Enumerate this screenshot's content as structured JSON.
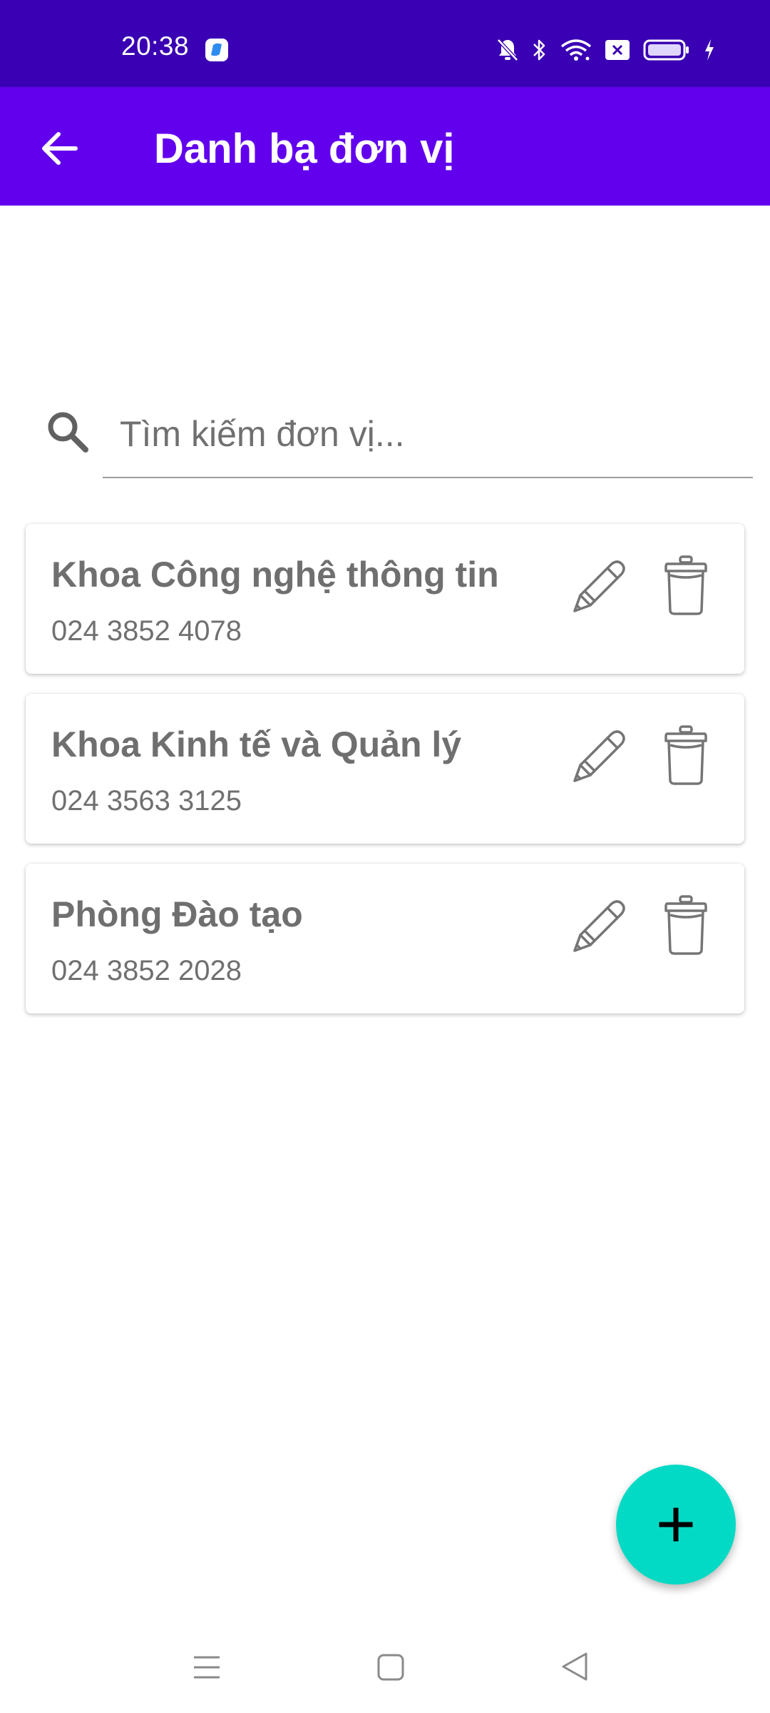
{
  "status_bar": {
    "time": "20:38",
    "icons": [
      "app-notification-icon",
      "bell-off-icon",
      "bluetooth-icon",
      "wifi-icon",
      "sim-off-icon",
      "battery-icon",
      "charging-icon"
    ]
  },
  "app_bar": {
    "back_icon": "arrow-back-icon",
    "title": "Danh bạ đơn vị"
  },
  "search": {
    "icon": "search-icon",
    "placeholder": "Tìm kiếm đơn vị...",
    "value": ""
  },
  "units": [
    {
      "name": "Khoa Công nghệ thông tin",
      "phone": "024 3852 4078"
    },
    {
      "name": "Khoa Kinh tế và Quản lý",
      "phone": "024 3563 3125"
    },
    {
      "name": "Phòng Đào tạo",
      "phone": "024 3852 2028"
    }
  ],
  "actions": {
    "edit_icon": "pencil-icon",
    "delete_icon": "trash-icon",
    "add_icon": "plus-icon"
  },
  "nav_bar": {
    "icons": [
      "menu-icon",
      "home-icon",
      "back-triangle-icon"
    ]
  },
  "colors": {
    "status_bar": "#3a00b3",
    "app_bar": "#6200ee",
    "fab": "#03dac5",
    "card_text": "#6f6f6f"
  }
}
